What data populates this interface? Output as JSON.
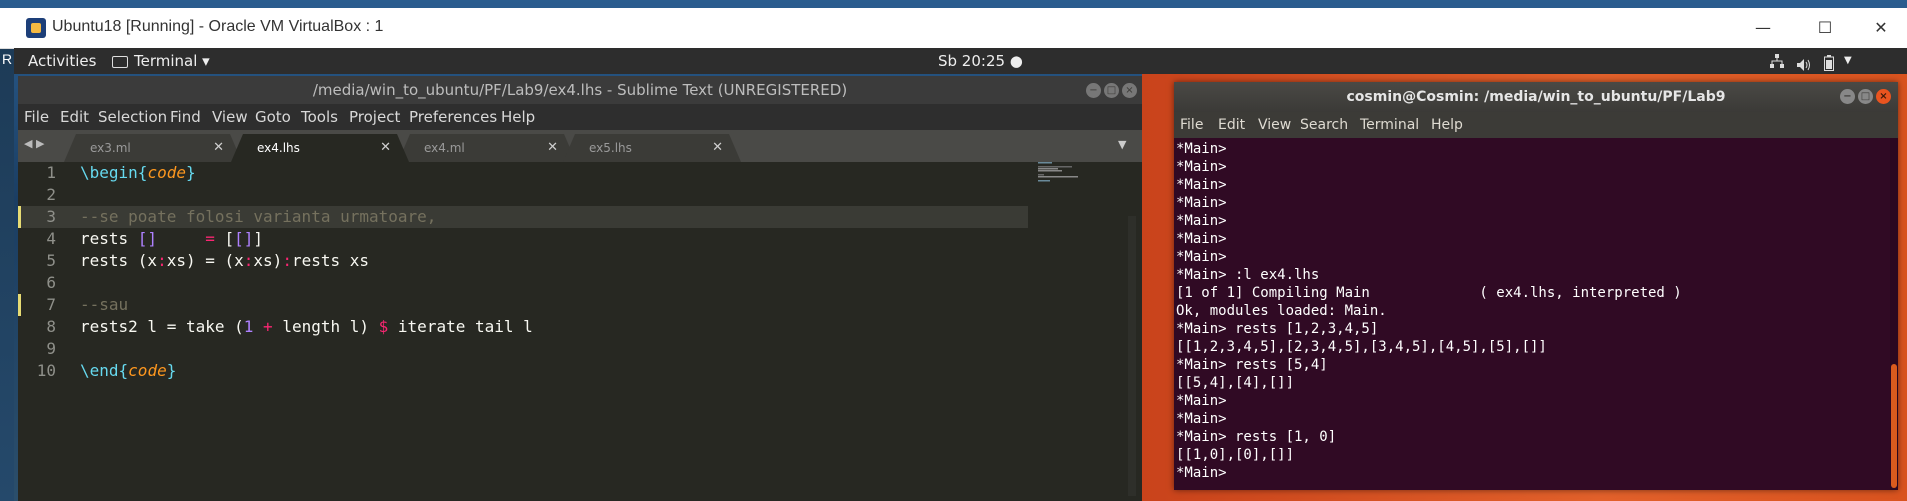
{
  "vbox_window": {
    "title": "Ubuntu18 [Running] - Oracle VM VirtualBox : 1",
    "minimize": "—",
    "maximize": "☐",
    "close": "✕"
  },
  "desktop": {
    "edge_letter": "R"
  },
  "ubuntu_topbar": {
    "activities": "Activities",
    "app_menu": "Terminal ▾",
    "clock": "Sb 20:25 ●",
    "tray": [
      "network-icon",
      "volume-icon",
      "battery-icon",
      "power-menu-icon"
    ]
  },
  "sublime": {
    "title": "/media/win_to_ubuntu/PF/Lab9/ex4.lhs - Sublime Text (UNREGISTERED)",
    "menu": [
      "File",
      "Edit",
      "Selection",
      "Find",
      "View",
      "Goto",
      "Tools",
      "Project",
      "Preferences",
      "Help"
    ],
    "tabs": [
      {
        "label": "ex3.ml",
        "active": false
      },
      {
        "label": "ex4.lhs",
        "active": true
      },
      {
        "label": "ex4.ml",
        "active": false
      },
      {
        "label": "ex5.lhs",
        "active": false
      }
    ],
    "tab_close": "✕",
    "tab_dropdown": "▼",
    "nav_arrows": "◀ ▶",
    "line_numbers": [
      "1",
      "2",
      "3",
      "4",
      "5",
      "6",
      "7",
      "8",
      "9",
      "10"
    ],
    "code": {
      "l1_a": "\\begin{",
      "l1_b": "code",
      "l1_c": "}",
      "l3": "--se poate folosi varianta urmatoare,",
      "l4_a": "rests ",
      "l4_b": "[]",
      "l4_c": "     ",
      "l4_d": "=",
      "l4_e": " [",
      "l4_f": "[]",
      "l4_g": "]",
      "l5_a": "rests (x",
      "l5_b": ":",
      "l5_c": "xs) = (x",
      "l5_d": ":",
      "l5_e": "xs)",
      "l5_f": ":",
      "l5_g": "rests xs",
      "l7": "--sau",
      "l8_a": "rests2 l = take (",
      "l8_b": "1",
      "l8_c": " + ",
      "l8_d": "length l) ",
      "l8_e": "$",
      "l8_f": " iterate tail l",
      "l10_a": "\\end{",
      "l10_b": "code",
      "l10_c": "}"
    }
  },
  "terminal": {
    "title": "cosmin@Cosmin: /media/win_to_ubuntu/PF/Lab9",
    "menu": [
      "File",
      "Edit",
      "View",
      "Search",
      "Terminal",
      "Help"
    ],
    "lines": [
      "*Main>",
      "*Main>",
      "*Main>",
      "*Main>",
      "*Main>",
      "*Main>",
      "*Main>",
      "*Main> :l ex4.lhs",
      "[1 of 1] Compiling Main             ( ex4.lhs, interpreted )",
      "Ok, modules loaded: Main.",
      "*Main> rests [1,2,3,4,5]",
      "[[1,2,3,4,5],[2,3,4,5],[3,4,5],[4,5],[5],[]]",
      "*Main> rests [5,4]",
      "[[5,4],[4],[]]",
      "*Main>",
      "*Main>",
      "*Main> rests [1, 0]",
      "[[1,0],[0],[]]",
      "*Main>"
    ]
  }
}
